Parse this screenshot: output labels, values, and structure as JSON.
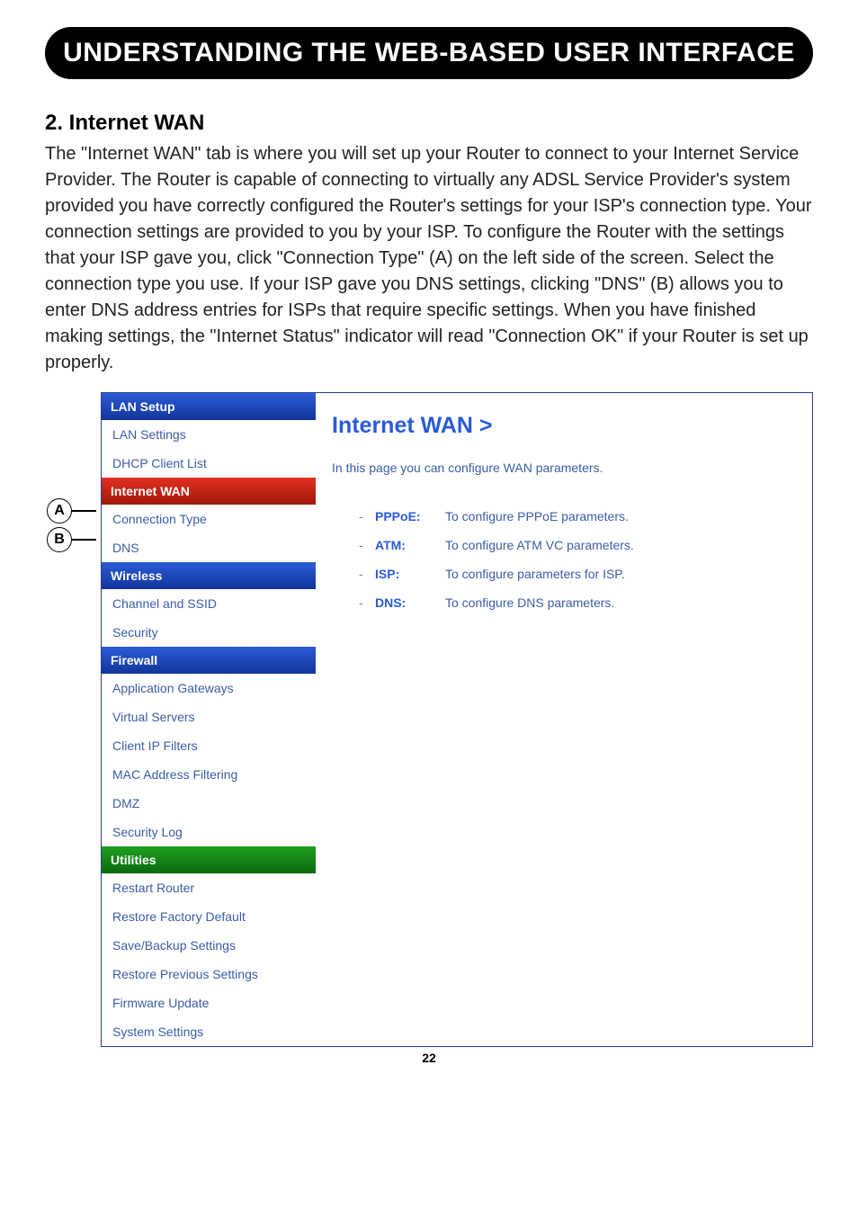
{
  "banner": "UNDERSTANDING THE WEB-BASED USER INTERFACE",
  "heading": "2. Internet WAN",
  "body": "The \"Internet WAN\" tab is where you will set up your Router to connect to your Internet Service Provider. The Router is capable of connecting to virtually any ADSL Service Provider's system provided you have correctly configured the Router's settings for your ISP's connection type. Your connection settings are provided to you by your ISP. To configure the Router with the settings that your ISP gave you, click \"Connection Type\" (A) on the left side of the screen. Select the connection type you use. If your ISP gave you DNS settings, clicking \"DNS\" (B) allows you to enter DNS address entries for ISPs that require specific settings. When you have finished making settings, the \"Internet Status\" indicator will read \"Connection OK\" if your Router is set up properly.",
  "callouts": {
    "a": "A",
    "b": "B"
  },
  "nav": {
    "lan_setup": "LAN Setup",
    "lan_settings": "LAN Settings",
    "dhcp_client_list": "DHCP Client List",
    "internet_wan": "Internet WAN",
    "connection_type": "Connection Type",
    "dns": "DNS",
    "wireless": "Wireless",
    "channel_and_ssid": "Channel and SSID",
    "security": "Security",
    "firewall": "Firewall",
    "application_gateways": "Application Gateways",
    "virtual_servers": "Virtual Servers",
    "client_ip_filters": "Client IP Filters",
    "mac_address_filtering": "MAC Address Filtering",
    "dmz": "DMZ",
    "security_log": "Security Log",
    "utilities": "Utilities",
    "restart_router": "Restart Router",
    "restore_factory_default": "Restore Factory Default",
    "save_backup_settings": "Save/Backup Settings",
    "restore_previous_settings": "Restore Previous Settings",
    "firmware_update": "Firmware Update",
    "system_settings": "System Settings"
  },
  "main": {
    "title": "Internet WAN >",
    "subtitle": "In this page you can configure WAN parameters.",
    "options": [
      {
        "label": "PPPoE:",
        "desc": "To configure PPPoE parameters."
      },
      {
        "label": "ATM:",
        "desc": "To configure ATM VC parameters."
      },
      {
        "label": "ISP:",
        "desc": "To configure parameters for ISP."
      },
      {
        "label": "DNS:",
        "desc": "To configure DNS parameters."
      }
    ]
  },
  "page_number": "22"
}
